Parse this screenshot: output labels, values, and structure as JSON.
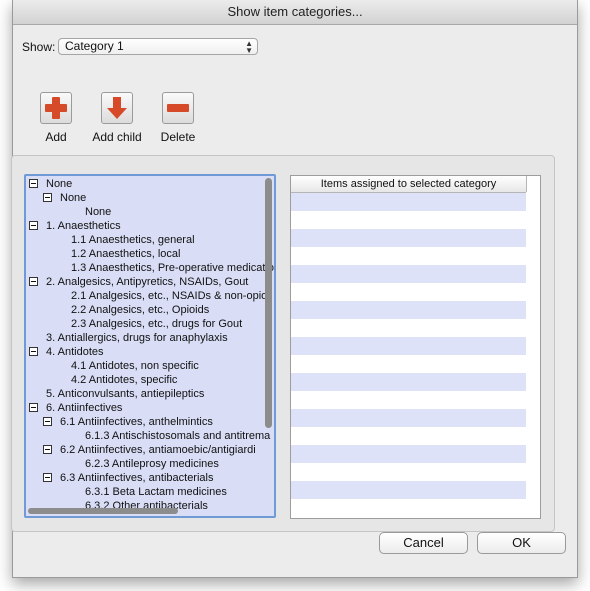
{
  "window": {
    "title": "Show item categories..."
  },
  "show": {
    "label": "Show:",
    "selected": "Category 1"
  },
  "toolbar": {
    "add_label": "Add",
    "add_child_label": "Add child",
    "delete_label": "Delete"
  },
  "tree": {
    "rows": [
      {
        "label": "None",
        "toggle": true
      },
      {
        "label": "None",
        "toggle": true
      },
      {
        "label": "None",
        "toggle": false
      },
      {
        "label": "1. Anaesthetics",
        "toggle": true
      },
      {
        "label": "1.1 Anaesthetics, general",
        "toggle": false
      },
      {
        "label": "1.2 Anaesthetics, local",
        "toggle": false
      },
      {
        "label": "1.3 Anaesthetics, Pre-operative medicatio",
        "toggle": false
      },
      {
        "label": "2. Analgesics, Antipyretics, NSAIDs, Gout",
        "toggle": true
      },
      {
        "label": "2.1  Analgesics, etc., NSAIDs & non-opioi",
        "toggle": false
      },
      {
        "label": "2.2  Analgesics, etc., Opioids",
        "toggle": false
      },
      {
        "label": "2.3  Analgesics, etc., drugs for Gout",
        "toggle": false
      },
      {
        "label": "3. Antiallergics, drugs for anaphylaxis",
        "toggle": false
      },
      {
        "label": "4. Antidotes",
        "toggle": true
      },
      {
        "label": "4.1  Antidotes,  non specific",
        "toggle": false
      },
      {
        "label": "4.2  Antidotes, specific",
        "toggle": false
      },
      {
        "label": "5. Anticonvulsants, antiepileptics",
        "toggle": false
      },
      {
        "label": "6. Antiinfectives",
        "toggle": true
      },
      {
        "label": "6.1  Antiinfectives, anthelmintics",
        "toggle": true
      },
      {
        "label": "6.1.3 Antischistosomals and antitrema",
        "toggle": false
      },
      {
        "label": "6.2 Antiinfectives, antiamoebic/antigiardi",
        "toggle": true
      },
      {
        "label": "6.2.3 Antileprosy medicines",
        "toggle": false
      },
      {
        "label": "6.3 Antiinfectives, antibacterials",
        "toggle": true
      },
      {
        "label": "6.3.1 Beta Lactam medicines",
        "toggle": false
      },
      {
        "label": "6.3.2 Other antibacterials",
        "toggle": false
      }
    ]
  },
  "items_table": {
    "header": "Items assigned to selected category"
  },
  "buttons": {
    "cancel": "Cancel",
    "ok": "OK"
  },
  "colors": {
    "selection_bg": "#d9def6",
    "focus_ring": "#6f9ad6",
    "stripe": "#dde2f8",
    "icon_red": "#d64a2a"
  }
}
